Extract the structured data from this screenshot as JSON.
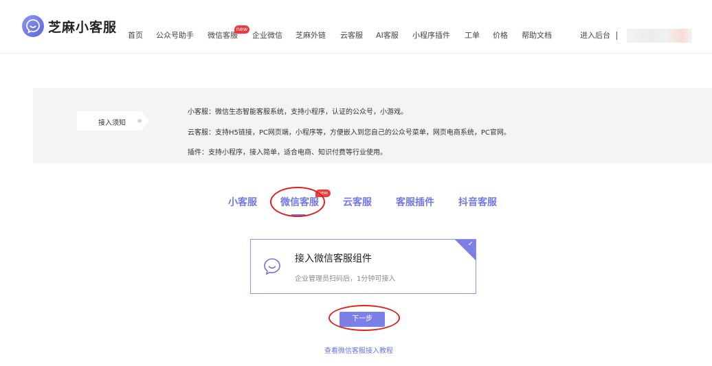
{
  "header": {
    "logo_text": "芝麻小客服",
    "nav": [
      {
        "label": "首页"
      },
      {
        "label": "公众号助手"
      },
      {
        "label": "微信客服"
      },
      {
        "label": "企业微信"
      },
      {
        "label": "芝麻外链"
      },
      {
        "label": "云客服"
      },
      {
        "label": "AI客服"
      },
      {
        "label": "小程序插件"
      },
      {
        "label": "工单"
      },
      {
        "label": "价格"
      },
      {
        "label": "帮助文档"
      }
    ],
    "new_badge": "new",
    "console_label": "进入后台",
    "separator": "|"
  },
  "notice": {
    "tag_label": "接入须知",
    "lines": [
      "小客服：微信生态智能客服系统，支持小程序，认证的公众号，小游戏。",
      "云客服：支持H5链接，PC网页端，小程序等，方便嵌入到您自己的公众号菜单，网页电商系统，PC官网。",
      "插件：支持小程序，接入简单，适合电商、知识付费等行业使用。"
    ]
  },
  "tabs": [
    {
      "label": "小客服"
    },
    {
      "label": "微信客服"
    },
    {
      "label": "云客服"
    },
    {
      "label": "客服插件"
    },
    {
      "label": "抖音客服"
    }
  ],
  "tab_new_badge": "new",
  "active_tab": "微信客服",
  "card": {
    "title": "接入微信客服组件",
    "description": "企业管理员扫码后，1分钟可接入",
    "check": "✓"
  },
  "next_button": "下一步",
  "tutorial_link": "查看微信客服接入教程",
  "colors": {
    "accent": "#7b80e8",
    "tab_text": "#7378e6",
    "new_badge": "#f13939",
    "annotation": "#e0201e"
  }
}
